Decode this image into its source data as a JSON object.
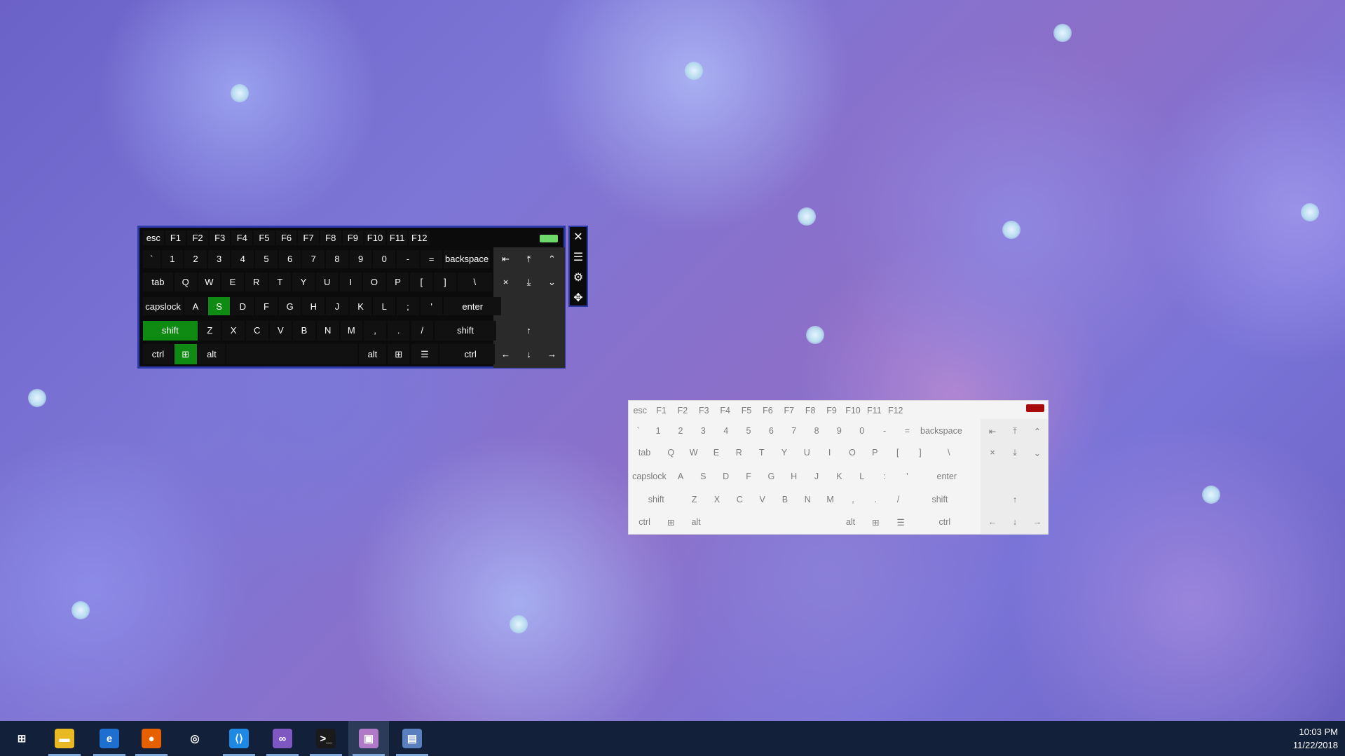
{
  "dark_keyboard": {
    "rows": [
      [
        "esc",
        "F1",
        "F2",
        "F3",
        "F4",
        "F5",
        "F6",
        "F7",
        "F8",
        "F9",
        "F10",
        "F11",
        "F12"
      ],
      [
        "`",
        "1",
        "2",
        "3",
        "4",
        "5",
        "6",
        "7",
        "8",
        "9",
        "0",
        "-",
        "=",
        "backspace"
      ],
      [
        "tab",
        "Q",
        "W",
        "E",
        "R",
        "T",
        "Y",
        "U",
        "I",
        "O",
        "P",
        "[",
        "]",
        "\\"
      ],
      [
        "capslock",
        "A",
        "S",
        "D",
        "F",
        "G",
        "H",
        "J",
        "K",
        "L",
        ";",
        "'",
        "enter"
      ],
      [
        "shift",
        "Z",
        "X",
        "C",
        "V",
        "B",
        "N",
        "M",
        ",",
        ".",
        "/",
        "shift"
      ],
      [
        "ctrl",
        "⊞",
        "alt",
        "",
        "alt",
        "⊞",
        "☰",
        "ctrl"
      ]
    ],
    "nav": {
      "home": "⇤",
      "pgup": "⤒",
      "up_chevron": "⌃",
      "del": "×",
      "pgdn": "⤓",
      "down_chevron": "⌄",
      "up": "↑",
      "left": "←",
      "down": "↓",
      "right": "→"
    },
    "active_keys": [
      "S",
      "shift",
      "⊞"
    ],
    "indicator_color": "#6fd86a"
  },
  "side_tools": {
    "close": "✕",
    "layout": "☰",
    "settings": "⚙",
    "move": "✥"
  },
  "light_keyboard": {
    "rows": [
      [
        "esc",
        "F1",
        "F2",
        "F3",
        "F4",
        "F5",
        "F6",
        "F7",
        "F8",
        "F9",
        "F10",
        "F11",
        "F12"
      ],
      [
        "`",
        "1",
        "2",
        "3",
        "4",
        "5",
        "6",
        "7",
        "8",
        "9",
        "0",
        "-",
        "=",
        "backspace"
      ],
      [
        "tab",
        "Q",
        "W",
        "E",
        "R",
        "T",
        "Y",
        "U",
        "I",
        "O",
        "P",
        "[",
        "]",
        "\\"
      ],
      [
        "capslock",
        "A",
        "S",
        "D",
        "F",
        "G",
        "H",
        "J",
        "K",
        "L",
        ":",
        "'",
        "enter"
      ],
      [
        "shift",
        "Z",
        "X",
        "C",
        "V",
        "B",
        "N",
        "M",
        ",",
        ".",
        "/",
        "shift"
      ],
      [
        "ctrl",
        "⊞",
        "alt",
        "",
        "alt",
        "⊞",
        "☰",
        "ctrl"
      ]
    ],
    "nav": {
      "home": "⇤",
      "pgup": "⤒",
      "up_chevron": "⌃",
      "del": "×",
      "pgdn": "⤓",
      "down_chevron": "⌄",
      "up": "↑",
      "left": "←",
      "down": "↓",
      "right": "→"
    },
    "indicator_color": "#a80b0b"
  },
  "taskbar": {
    "apps": [
      {
        "name": "start",
        "glyph": "⊞",
        "color": "#13203a"
      },
      {
        "name": "file-explorer",
        "glyph": "▬",
        "color": "#e8b923"
      },
      {
        "name": "edge",
        "glyph": "e",
        "color": "#1e6fd0"
      },
      {
        "name": "firefox",
        "glyph": "●",
        "color": "#e66000"
      },
      {
        "name": "groove",
        "glyph": "◎",
        "color": "#13203a"
      },
      {
        "name": "vscode",
        "glyph": "⟨⟩",
        "color": "#1e88e5"
      },
      {
        "name": "visual-studio",
        "glyph": "∞",
        "color": "#7e57c2"
      },
      {
        "name": "terminal",
        "glyph": ">_",
        "color": "#1a1a1a"
      },
      {
        "name": "keyboard-app",
        "glyph": "▣",
        "color": "#b07ac8"
      },
      {
        "name": "image-app",
        "glyph": "▤",
        "color": "#5a7fbf"
      }
    ],
    "time": "10:03 PM",
    "date": "11/22/2018"
  }
}
